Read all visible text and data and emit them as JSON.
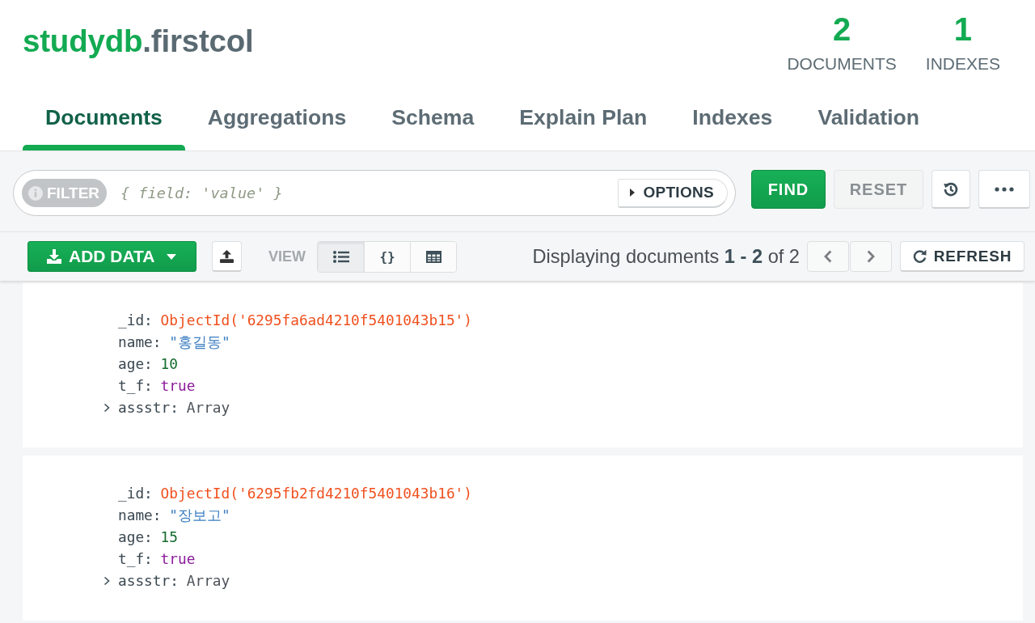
{
  "header": {
    "database": "studydb",
    "collection": ".firstcol",
    "stats": [
      {
        "value": "2",
        "label": "DOCUMENTS"
      },
      {
        "value": "1",
        "label": "INDEXES"
      }
    ]
  },
  "tabs": [
    {
      "label": "Documents",
      "selected": true
    },
    {
      "label": "Aggregations",
      "selected": false
    },
    {
      "label": "Schema",
      "selected": false
    },
    {
      "label": "Explain Plan",
      "selected": false
    },
    {
      "label": "Indexes",
      "selected": false
    },
    {
      "label": "Validation",
      "selected": false
    }
  ],
  "query_bar": {
    "filter_label": "FILTER",
    "placeholder": "{ field: 'value' }",
    "options_label": "OPTIONS",
    "find_label": "FIND",
    "reset": {
      "label": "RESET",
      "disabled": true
    }
  },
  "toolbar": {
    "add_data_label": "ADD DATA",
    "view_label": "VIEW",
    "view_modes": [
      {
        "kind": "list",
        "selected": true
      },
      {
        "kind": "json",
        "label": "{}",
        "selected": false
      },
      {
        "kind": "table",
        "selected": false
      }
    ],
    "summary": "Displaying documents **1 - 2** of 2",
    "refresh_label": "REFRESH"
  },
  "documents": [
    {
      "fields": [
        {
          "key": "_id:",
          "value": "ObjectId('6295fa6ad4210f5401043b15')",
          "kind": "objectid"
        },
        {
          "key": "name:",
          "value": "\"홍길동\"",
          "kind": "string"
        },
        {
          "key": "age:",
          "value": "10",
          "kind": "number"
        },
        {
          "key": "t_f:",
          "value": "true",
          "kind": "boolean"
        },
        {
          "key": "assstr:",
          "value": "Array",
          "kind": "array",
          "expanded": false
        }
      ]
    },
    {
      "fields": [
        {
          "key": "_id:",
          "value": "ObjectId('6295fb2fd4210f5401043b16')",
          "kind": "objectid"
        },
        {
          "key": "name:",
          "value": "\"장보고\"",
          "kind": "string"
        },
        {
          "key": "age:",
          "value": "15",
          "kind": "number"
        },
        {
          "key": "t_f:",
          "value": "true",
          "kind": "boolean"
        },
        {
          "key": "assstr:",
          "value": "Array",
          "kind": "array",
          "expanded": false
        }
      ]
    }
  ]
}
